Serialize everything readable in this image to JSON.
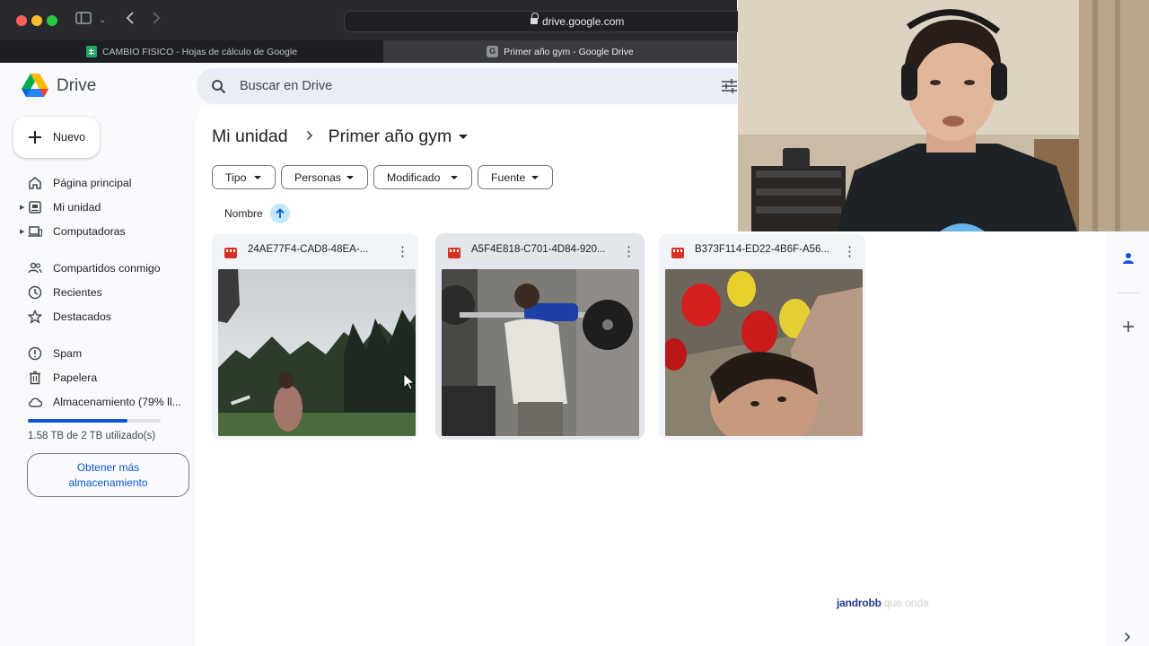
{
  "browser": {
    "url": "drive.google.com",
    "tabs": [
      {
        "label": "CAMBIO FISICO - Hojas de cálculo de Google",
        "favicon": "sheets-icon",
        "active": false
      },
      {
        "label": "Primer año gym - Google Drive",
        "favicon": "G",
        "active": true
      }
    ]
  },
  "app": {
    "name": "Drive",
    "search_placeholder": "Buscar en Drive",
    "new_button": "Nuevo"
  },
  "sidebar": {
    "items": [
      {
        "label": "Página principal",
        "icon": "home-icon"
      },
      {
        "label": "Mi unidad",
        "icon": "my-drive-icon"
      },
      {
        "label": "Computadoras",
        "icon": "computer-icon"
      },
      {
        "label": "Compartidos conmigo",
        "icon": "people-icon"
      },
      {
        "label": "Recientes",
        "icon": "clock-icon"
      },
      {
        "label": "Destacados",
        "icon": "star-icon"
      },
      {
        "label": "Spam",
        "icon": "spam-icon"
      },
      {
        "label": "Papelera",
        "icon": "trash-icon"
      },
      {
        "label": "Almacenamiento (79% ll...",
        "icon": "cloud-icon"
      }
    ],
    "storage": {
      "used_fraction": 0.79,
      "text": "1.58 TB de 2 TB utilizado(s)",
      "button": "Obtener más almacenamiento"
    }
  },
  "main": {
    "breadcrumb": {
      "root": "Mi unidad",
      "current": "Primer año gym"
    },
    "filters": [
      "Tipo",
      "Personas",
      "Modificado",
      "Fuente"
    ],
    "sort": {
      "label": "Nombre",
      "direction": "ascending"
    },
    "files": [
      {
        "name": "24AE77F4-CAD8-48EA-...",
        "type": "video"
      },
      {
        "name": "A5F4E818-C701-4D84-920...",
        "type": "video"
      },
      {
        "name": "B373F114-ED22-4B6F-A56...",
        "type": "video"
      }
    ]
  },
  "chat": {
    "user": "jandrobb",
    "message": "que onda"
  },
  "colors": {
    "accent": "#0b57d0",
    "chrome": "#28292c",
    "drive_bg": "#f8fafd",
    "video_icon": "#d93025"
  }
}
